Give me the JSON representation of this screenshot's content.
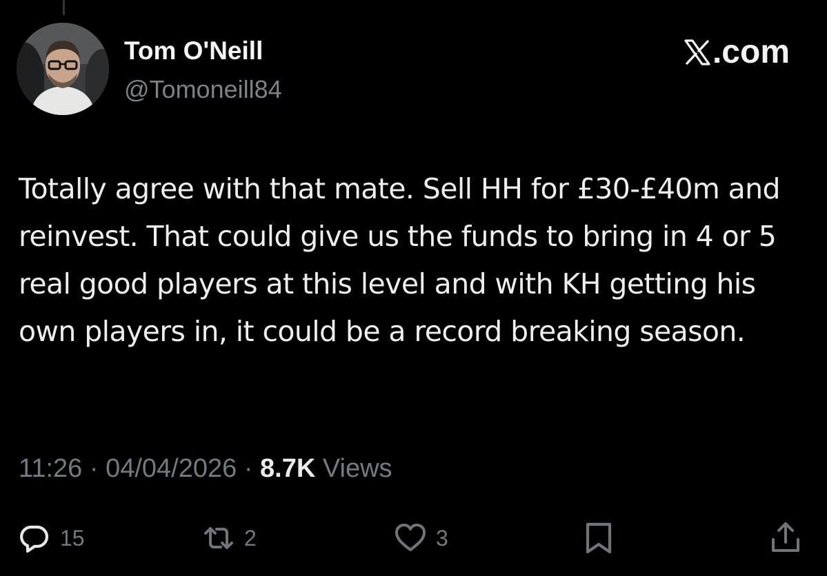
{
  "author": {
    "display_name": "Tom O'Neill",
    "handle": "@Tomoneill84"
  },
  "brand": {
    "label": ".com",
    "icon": "x-logo-icon"
  },
  "tweet": {
    "text": "Totally agree with that mate. Sell HH for £30-£40m and reinvest. That could give us the funds to bring in 4 or 5 real good players at this level and with KH getting his own players in, it could be a record breaking season."
  },
  "meta": {
    "time": "11:26",
    "separator": "·",
    "date": "04/04/2026",
    "views_count": "8.7K",
    "views_label": "Views"
  },
  "actions": {
    "reply": {
      "icon": "reply-icon",
      "count": "15"
    },
    "repost": {
      "icon": "repost-icon",
      "count": "2"
    },
    "like": {
      "icon": "heart-icon",
      "count": "3"
    },
    "bookmark": {
      "icon": "bookmark-icon"
    },
    "share": {
      "icon": "share-icon"
    }
  },
  "colors": {
    "background": "#000000",
    "primary_text": "#e7e9ea",
    "secondary_text": "#71767b"
  }
}
